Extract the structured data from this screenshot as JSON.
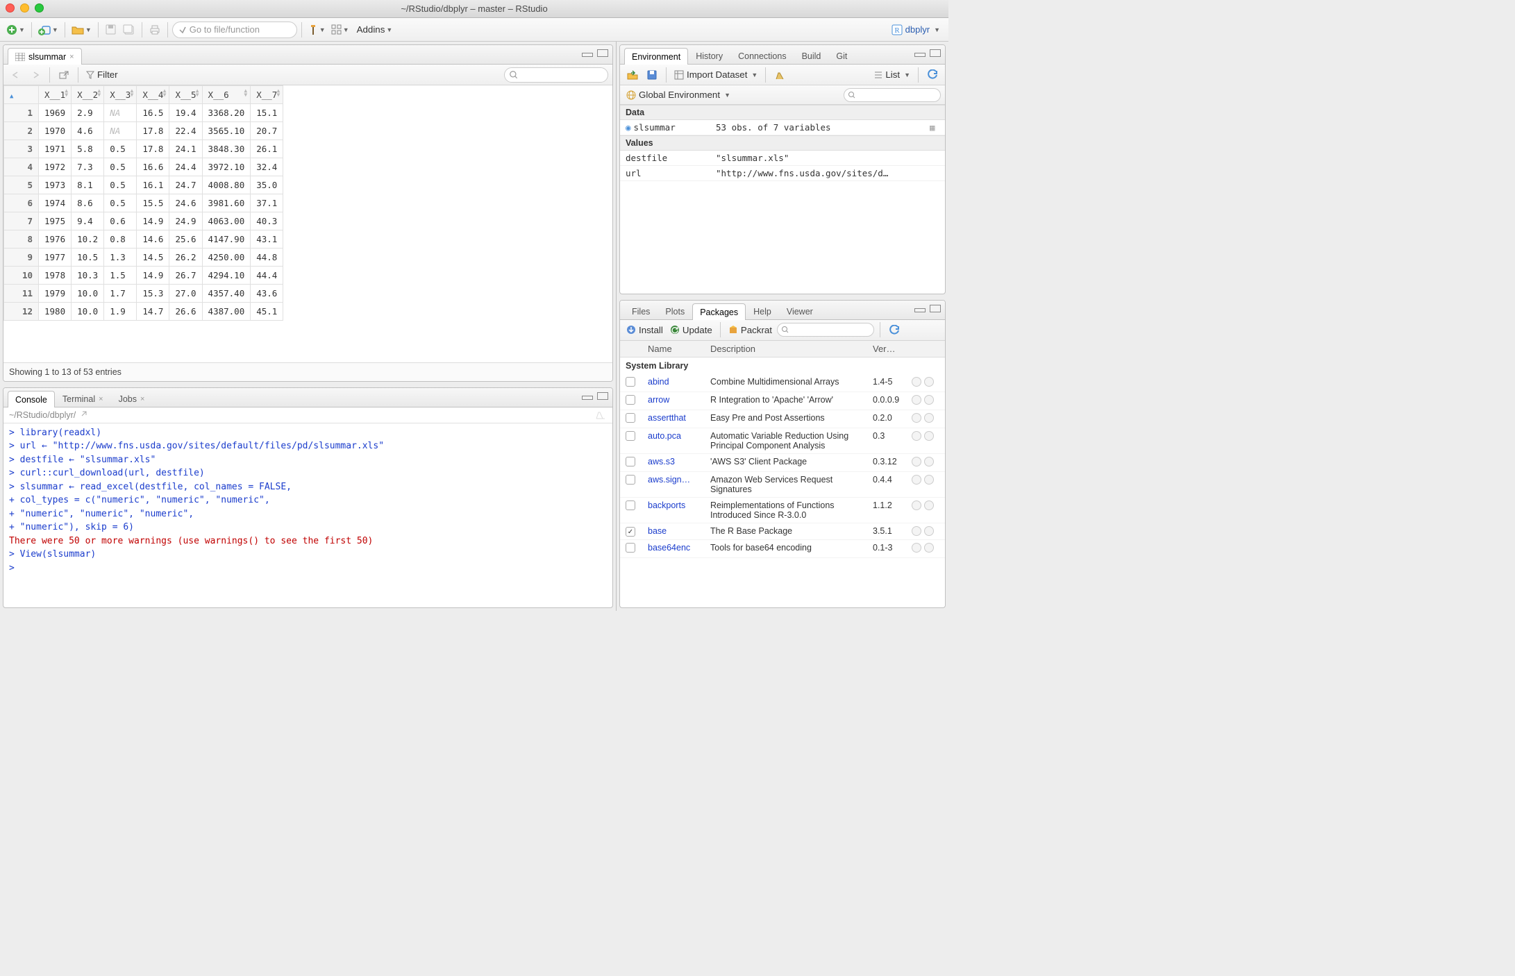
{
  "window": {
    "title": "~/RStudio/dbplyr – master – RStudio"
  },
  "toolbar": {
    "goto_placeholder": "Go to file/function",
    "addins": "Addins",
    "project": "dbplyr"
  },
  "source": {
    "tab": "slsummar",
    "filter_label": "Filter",
    "columns": [
      "",
      "X__1",
      "X__2",
      "X__3",
      "X__4",
      "X__5",
      "X__6",
      "X__7"
    ],
    "rows": [
      [
        "1",
        "1969",
        "2.9",
        "NA",
        "16.5",
        "19.4",
        "3368.20",
        "15.1"
      ],
      [
        "2",
        "1970",
        "4.6",
        "NA",
        "17.8",
        "22.4",
        "3565.10",
        "20.7"
      ],
      [
        "3",
        "1971",
        "5.8",
        "0.5",
        "17.8",
        "24.1",
        "3848.30",
        "26.1"
      ],
      [
        "4",
        "1972",
        "7.3",
        "0.5",
        "16.6",
        "24.4",
        "3972.10",
        "32.4"
      ],
      [
        "5",
        "1973",
        "8.1",
        "0.5",
        "16.1",
        "24.7",
        "4008.80",
        "35.0"
      ],
      [
        "6",
        "1974",
        "8.6",
        "0.5",
        "15.5",
        "24.6",
        "3981.60",
        "37.1"
      ],
      [
        "7",
        "1975",
        "9.4",
        "0.6",
        "14.9",
        "24.9",
        "4063.00",
        "40.3"
      ],
      [
        "8",
        "1976",
        "10.2",
        "0.8",
        "14.6",
        "25.6",
        "4147.90",
        "43.1"
      ],
      [
        "9",
        "1977",
        "10.5",
        "1.3",
        "14.5",
        "26.2",
        "4250.00",
        "44.8"
      ],
      [
        "10",
        "1978",
        "10.3",
        "1.5",
        "14.9",
        "26.7",
        "4294.10",
        "44.4"
      ],
      [
        "11",
        "1979",
        "10.0",
        "1.7",
        "15.3",
        "27.0",
        "4357.40",
        "43.6"
      ],
      [
        "12",
        "1980",
        "10.0",
        "1.9",
        "14.7",
        "26.6",
        "4387.00",
        "45.1"
      ]
    ],
    "status": "Showing 1 to 13 of 53 entries"
  },
  "console": {
    "tabs": [
      "Console",
      "Terminal",
      "Jobs"
    ],
    "path": "~/RStudio/dbplyr/",
    "lines": [
      {
        "cls": "blue",
        "text": "> library(readxl)"
      },
      {
        "cls": "blue",
        "text": "> url ← \"http://www.fns.usda.gov/sites/default/files/pd/slsummar.xls\""
      },
      {
        "cls": "blue",
        "text": "> destfile ← \"slsummar.xls\""
      },
      {
        "cls": "blue",
        "text": "> curl::curl_download(url, destfile)"
      },
      {
        "cls": "blue",
        "text": "> slsummar ← read_excel(destfile, col_names = FALSE,"
      },
      {
        "cls": "blue",
        "text": "+     col_types = c(\"numeric\", \"numeric\", \"numeric\","
      },
      {
        "cls": "blue",
        "text": "+         \"numeric\", \"numeric\", \"numeric\","
      },
      {
        "cls": "blue",
        "text": "+         \"numeric\"), skip = 6)"
      },
      {
        "cls": "red",
        "text": "There were 50 or more warnings (use warnings() to see the first 50)"
      },
      {
        "cls": "blue",
        "text": "> View(slsummar)"
      },
      {
        "cls": "blue",
        "text": "> "
      }
    ]
  },
  "env": {
    "tabs": [
      "Environment",
      "History",
      "Connections",
      "Build",
      "Git"
    ],
    "import": "Import Dataset",
    "listmode": "List",
    "scope": "Global Environment",
    "sections": [
      {
        "title": "Data",
        "rows": [
          {
            "icon": "play",
            "k": "slsummar",
            "v": "53 obs. of 7 variables",
            "grid": true
          }
        ]
      },
      {
        "title": "Values",
        "rows": [
          {
            "k": "destfile",
            "v": "\"slsummar.xls\""
          },
          {
            "k": "url",
            "v": "\"http://www.fns.usda.gov/sites/d…"
          }
        ]
      }
    ]
  },
  "pkg": {
    "tabs": [
      "Files",
      "Plots",
      "Packages",
      "Help",
      "Viewer"
    ],
    "install": "Install",
    "update": "Update",
    "packrat": "Packrat",
    "cols": {
      "name": "Name",
      "desc": "Description",
      "ver": "Ver…"
    },
    "section": "System Library",
    "rows": [
      {
        "chk": false,
        "name": "abind",
        "desc": "Combine Multidimensional Arrays",
        "ver": "1.4-5"
      },
      {
        "chk": false,
        "name": "arrow",
        "desc": "R Integration to 'Apache' 'Arrow'",
        "ver": "0.0.0.9"
      },
      {
        "chk": false,
        "name": "assertthat",
        "desc": "Easy Pre and Post Assertions",
        "ver": "0.2.0"
      },
      {
        "chk": false,
        "name": "auto.pca",
        "desc": "Automatic Variable Reduction Using Principal Component Analysis",
        "ver": "0.3"
      },
      {
        "chk": false,
        "name": "aws.s3",
        "desc": "'AWS S3' Client Package",
        "ver": "0.3.12"
      },
      {
        "chk": false,
        "name": "aws.sign…",
        "desc": "Amazon Web Services Request Signatures",
        "ver": "0.4.4"
      },
      {
        "chk": false,
        "name": "backports",
        "desc": "Reimplementations of Functions Introduced Since R-3.0.0",
        "ver": "1.1.2"
      },
      {
        "chk": true,
        "name": "base",
        "desc": "The R Base Package",
        "ver": "3.5.1"
      },
      {
        "chk": false,
        "name": "base64enc",
        "desc": "Tools for base64 encoding",
        "ver": "0.1-3"
      }
    ]
  }
}
